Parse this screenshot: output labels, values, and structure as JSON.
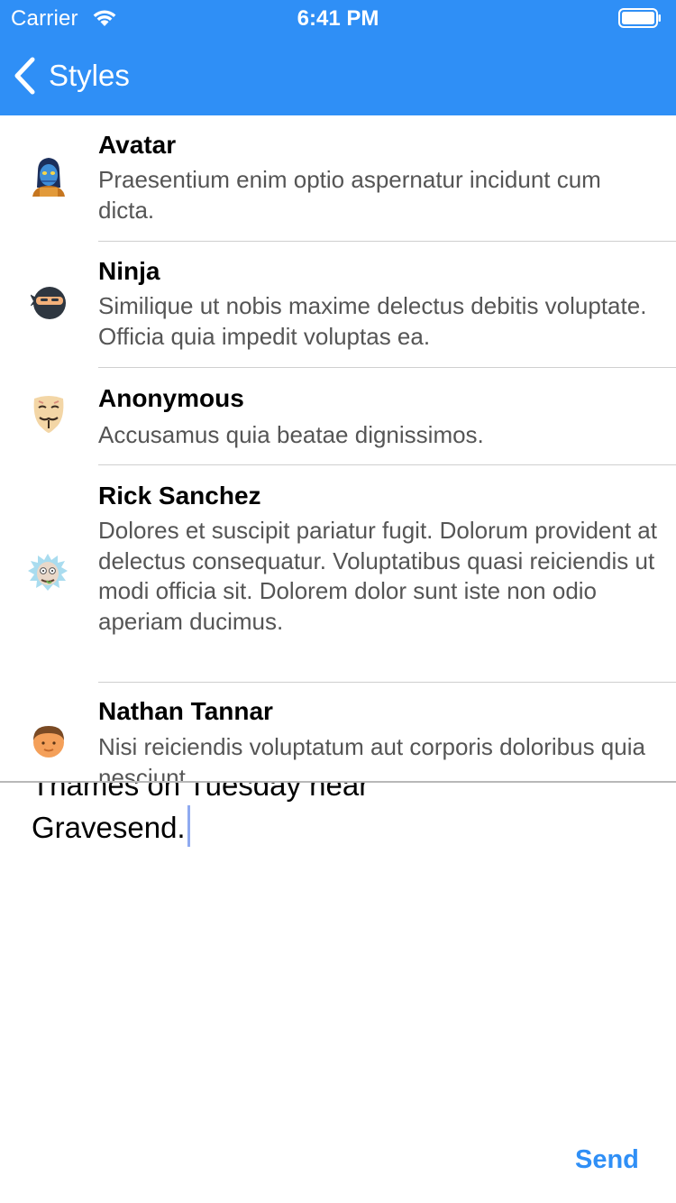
{
  "status_bar": {
    "carrier": "Carrier",
    "time": "6:41 PM"
  },
  "nav": {
    "back_label": "Styles"
  },
  "list": {
    "items": [
      {
        "title": "Avatar",
        "body": "Praesentium enim optio aspernatur incidunt cum dicta.",
        "icon": "avatar-icon"
      },
      {
        "title": "Ninja",
        "body": "Similique ut nobis maxime delectus debitis voluptate. Officia quia impedit voluptas ea.",
        "icon": "ninja-icon"
      },
      {
        "title": "Anonymous",
        "body": "Accusamus quia beatae dignissimos.",
        "icon": "anonymous-mask-icon"
      },
      {
        "title": "Rick Sanchez",
        "body": "Dolores et suscipit pariatur fugit. Dolorum provident at delectus consequatur. Voluptatibus quasi reiciendis ut modi officia sit. Dolorem dolor sunt iste non odio aperiam ducimus.",
        "icon": "rick-sanchez-icon"
      },
      {
        "title": "Nathan Tannar",
        "body": "Nisi reiciendis voluptatum aut corporis doloribus quia nesciunt.",
        "icon": "person-icon"
      }
    ]
  },
  "composer": {
    "text": "Thames on Tuesday near\nGravesend.",
    "send_label": "Send"
  },
  "colors": {
    "accent": "#2f8ff6",
    "body_text": "#555555",
    "separator": "#cfcfcf"
  }
}
